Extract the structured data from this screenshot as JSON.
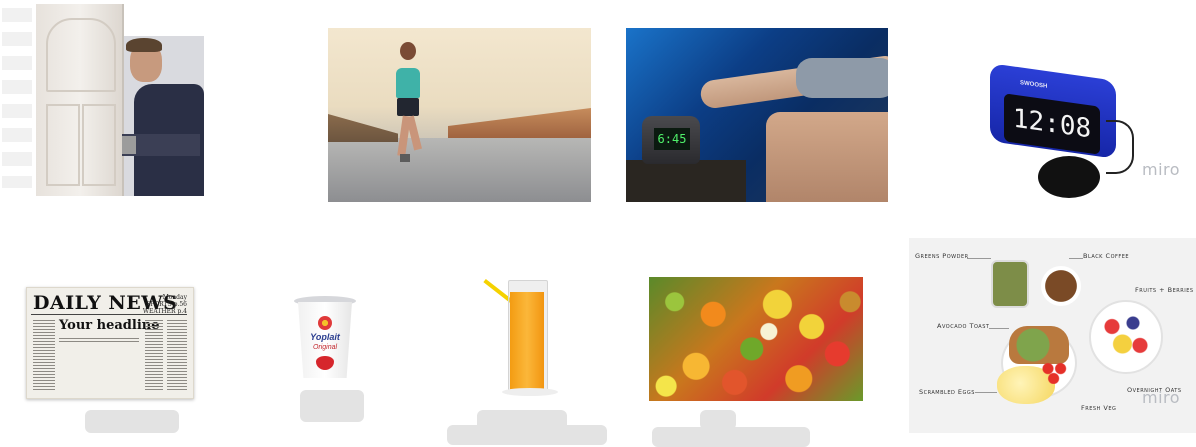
{
  "board": {
    "watermark_top": "miro",
    "watermark_bottom": "miro"
  },
  "images": {
    "top": [
      {
        "name": "man-leaving-door",
        "icon": "person-door-image"
      },
      {
        "name": "woman-running",
        "icon": "runner-image"
      },
      {
        "name": "hand-alarm-clock",
        "icon": "alarm-clock-hand-image"
      },
      {
        "name": "blue-alarm-clock",
        "icon": "alarm-clock-product-image"
      }
    ],
    "bottom": [
      {
        "name": "newspaper",
        "icon": "newspaper-image"
      },
      {
        "name": "yogurt-cup",
        "icon": "yogurt-image"
      },
      {
        "name": "orange-juice",
        "icon": "juice-glass-image"
      },
      {
        "name": "fruit-assortment",
        "icon": "fruit-image"
      },
      {
        "name": "breakfast-plate",
        "icon": "breakfast-image"
      }
    ]
  },
  "clock_photo": {
    "time": "6:45"
  },
  "clock_product": {
    "time": "12:08",
    "brand": "SWOOSH"
  },
  "newspaper": {
    "masthead": "DAILY NEWS",
    "headline": "Your headline",
    "side_lines": [
      "Monday",
      "SPORTS p.56",
      "WEATHER p.4"
    ]
  },
  "yogurt": {
    "brand": "Yoplait",
    "flavor": "Original"
  },
  "breakfast_labels": {
    "greens_powder": "Greens Powder",
    "black_coffee": "Black Coffee",
    "fruits_berries": "Fruits + Berries",
    "avocado_toast": "Avocado Toast",
    "scrambled_eggs": "Scrambled Eggs",
    "overnight_oats": "Overnight Oats",
    "fresh_veg": "Fresh Veg"
  },
  "colors": {
    "placeholder": "#e3e3e3",
    "watermark": "#b9bcc2",
    "clock_blue": "#1f33c4",
    "juice": "#f7a817"
  }
}
